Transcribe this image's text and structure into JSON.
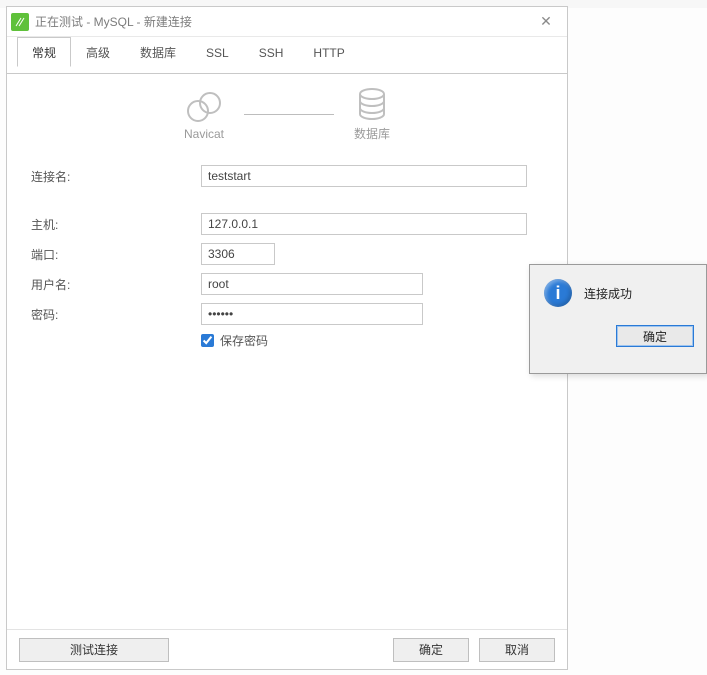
{
  "dialog": {
    "title": "正在测试 - MySQL - 新建连接",
    "close_glyph": "✕"
  },
  "tabs": {
    "items": [
      {
        "label": "常规"
      },
      {
        "label": "高级"
      },
      {
        "label": "数据库"
      },
      {
        "label": "SSL"
      },
      {
        "label": "SSH"
      },
      {
        "label": "HTTP"
      }
    ],
    "active_index": 0
  },
  "illustration": {
    "left_label": "Navicat",
    "right_label": "数据库"
  },
  "form": {
    "connection_name": {
      "label": "连接名:",
      "value": "teststart"
    },
    "host": {
      "label": "主机:",
      "value": "127.0.0.1"
    },
    "port": {
      "label": "端口:",
      "value": "3306"
    },
    "username": {
      "label": "用户名:",
      "value": "root"
    },
    "password": {
      "label": "密码:",
      "value": "••••••"
    },
    "save_password": {
      "label": "保存密码",
      "checked": true
    }
  },
  "footer": {
    "test_label": "测试连接",
    "ok_label": "确定",
    "cancel_label": "取消"
  },
  "popup": {
    "message": "连接成功",
    "ok_label": "确定",
    "info_glyph": "i"
  }
}
